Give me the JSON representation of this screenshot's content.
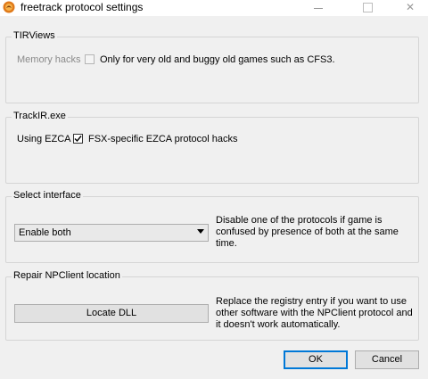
{
  "window": {
    "title": "freetrack protocol settings",
    "icon": "freetrack-app-icon",
    "minimize_icon": "minimize-icon",
    "maximize_icon": "maximize-icon",
    "close_glyph": "✕"
  },
  "tirviews": {
    "title": "TIRViews",
    "label": "Memory hacks",
    "checkbox_label": "Only for very old and buggy old games such as CFS3.",
    "checked": false,
    "enabled": false
  },
  "trackir": {
    "title": "TrackIR.exe",
    "label": "Using EZCA",
    "checkbox_label": "FSX-specific EZCA protocol hacks",
    "checked": true
  },
  "interface": {
    "title": "Select interface",
    "selected": "Enable both",
    "description": "Disable one of the protocols if game is confused by presence of both at the same time."
  },
  "npclient": {
    "title": "Repair NPClient location",
    "button_label": "Locate DLL",
    "description": "Replace the registry entry if you want to use other software with the NPClient protocol and it doesn't work automatically."
  },
  "footer": {
    "ok_label": "OK",
    "cancel_label": "Cancel"
  },
  "colors": {
    "accent": "#0078d7",
    "dialog_bg": "#f0f0f0"
  }
}
